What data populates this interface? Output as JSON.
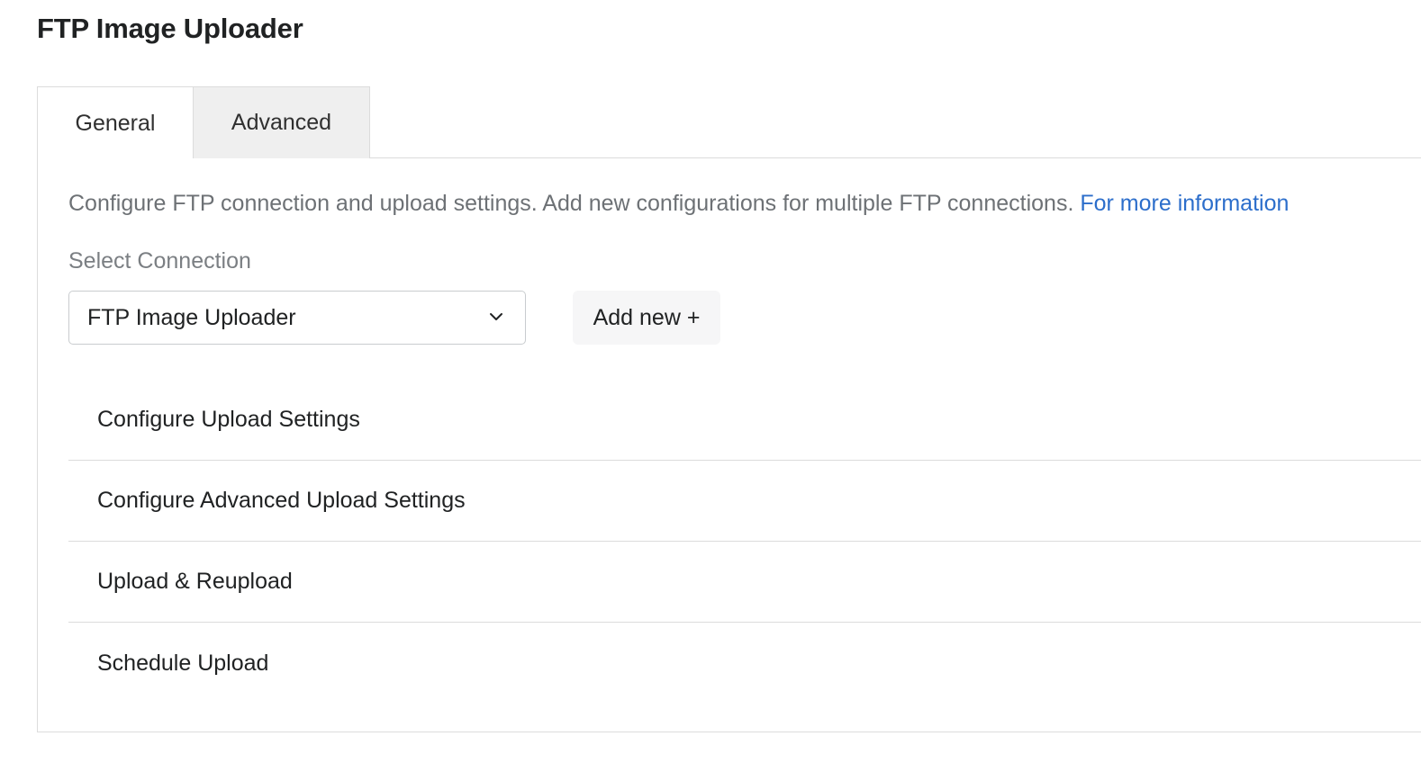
{
  "page": {
    "title": "FTP Image Uploader"
  },
  "tabs": [
    {
      "label": "General",
      "active": true
    },
    {
      "label": "Advanced",
      "active": false
    }
  ],
  "general": {
    "description": "Configure FTP connection and upload settings. Add new configurations for multiple FTP connections.",
    "more_info_link": "For more information",
    "select_label": "Select Connection",
    "select_value": "FTP Image Uploader",
    "add_new_label": "Add new +",
    "sections": [
      {
        "label": "Configure Upload Settings"
      },
      {
        "label": "Configure Advanced Upload Settings"
      },
      {
        "label": "Upload & Reupload"
      },
      {
        "label": "Schedule Upload"
      }
    ]
  },
  "colors": {
    "link": "#2c6ecb",
    "inactive_tab_bg": "#efefef",
    "border": "#dcdcdc"
  },
  "icons": {
    "select_indicator": "chevron-down-icon"
  }
}
